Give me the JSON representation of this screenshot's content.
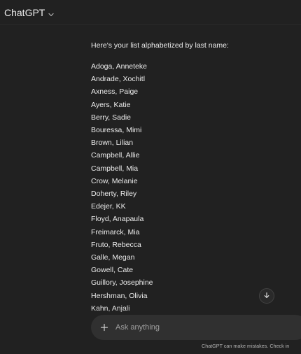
{
  "header": {
    "model_name": "ChatGPT"
  },
  "message": {
    "intro": "Here's your list alphabetized by last name:",
    "names": [
      "Adoga, Anneteke",
      "Andrade, Xochitl",
      "Axness, Paige",
      "Ayers, Katie",
      "Berry, Sadie",
      "Bouressa, Mimi",
      "Brown, Lilian",
      "Campbell, Allie",
      "Campbell, Mia",
      "Crow, Melanie",
      "Doherty, Riley",
      "Edejer, KK",
      "Floyd, Anapaula",
      "Freimarck, Mia",
      "Fruto, Rebecca",
      "Galle, Megan",
      "Gowell, Cate",
      "Guillory, Josephine",
      "Hershman, Olivia",
      "Kahn, Anjali"
    ]
  },
  "composer": {
    "placeholder": "Ask anything"
  },
  "footer": {
    "disclaimer": "ChatGPT can make mistakes. Check in"
  },
  "icons": {
    "model_menu": "chevron-down-icon",
    "scroll": "arrow-down-icon",
    "attach": "plus-icon"
  }
}
